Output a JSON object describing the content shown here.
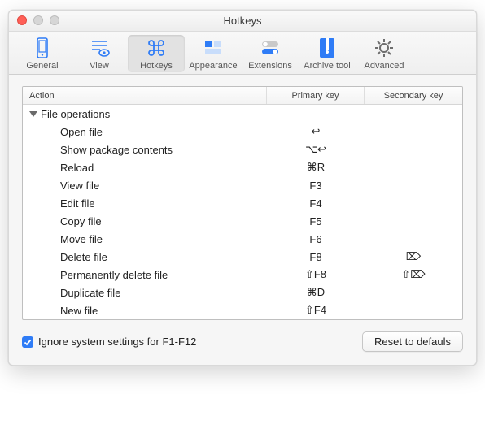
{
  "window": {
    "title": "Hotkeys"
  },
  "toolbar": {
    "items": [
      {
        "label": "General"
      },
      {
        "label": "View"
      },
      {
        "label": "Hotkeys",
        "active": true
      },
      {
        "label": "Appearance"
      },
      {
        "label": "Extensions"
      },
      {
        "label": "Archive tool"
      },
      {
        "label": "Advanced"
      }
    ]
  },
  "table": {
    "headers": {
      "action": "Action",
      "primary": "Primary key",
      "secondary": "Secondary key"
    },
    "group": "File operations",
    "rows": [
      {
        "action": "Open file",
        "primary": "↩",
        "secondary": ""
      },
      {
        "action": "Show package contents",
        "primary": "⌥↩",
        "secondary": ""
      },
      {
        "action": "Reload",
        "primary": "⌘R",
        "secondary": ""
      },
      {
        "action": "View file",
        "primary": "F3",
        "secondary": ""
      },
      {
        "action": "Edit file",
        "primary": "F4",
        "secondary": ""
      },
      {
        "action": "Copy file",
        "primary": "F5",
        "secondary": ""
      },
      {
        "action": "Move file",
        "primary": "F6",
        "secondary": ""
      },
      {
        "action": "Delete file",
        "primary": "F8",
        "secondary": "⌦"
      },
      {
        "action": "Permanently delete file",
        "primary": "⇧F8",
        "secondary": "⇧⌦"
      },
      {
        "action": "Duplicate file",
        "primary": "⌘D",
        "secondary": ""
      },
      {
        "action": "New file",
        "primary": "⇧F4",
        "secondary": ""
      }
    ]
  },
  "footer": {
    "checkbox_label": "Ignore system settings for F1-F12",
    "checked": true,
    "button": "Reset to defauls"
  },
  "colors": {
    "accent": "#2f7cf6"
  }
}
